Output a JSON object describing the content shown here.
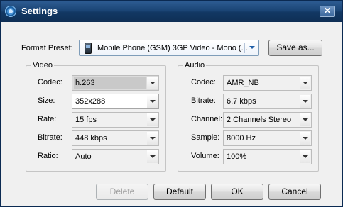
{
  "window": {
    "title": "Settings",
    "close_glyph": "✕"
  },
  "format_preset": {
    "label": "Format Preset:",
    "value": "Mobile Phone (GSM) 3GP Video - Mono (...",
    "icon": "phone-icon",
    "save_as_label": "Save as..."
  },
  "video": {
    "title": "Video",
    "fields": [
      {
        "label": "Codec:",
        "value": "h.263"
      },
      {
        "label": "Size:",
        "value": "352x288"
      },
      {
        "label": "Rate:",
        "value": "15 fps"
      },
      {
        "label": "Bitrate:",
        "value": "448 kbps"
      },
      {
        "label": "Ratio:",
        "value": "Auto"
      }
    ]
  },
  "audio": {
    "title": "Audio",
    "fields": [
      {
        "label": "Codec:",
        "value": "AMR_NB"
      },
      {
        "label": "Bitrate:",
        "value": "6.7 kbps"
      },
      {
        "label": "Channel:",
        "value": "2 Channels Stereo"
      },
      {
        "label": "Sample:",
        "value": "8000 Hz"
      },
      {
        "label": "Volume:",
        "value": "100%"
      }
    ]
  },
  "buttons": {
    "delete": "Delete",
    "default": "Default",
    "ok": "OK",
    "cancel": "Cancel"
  }
}
